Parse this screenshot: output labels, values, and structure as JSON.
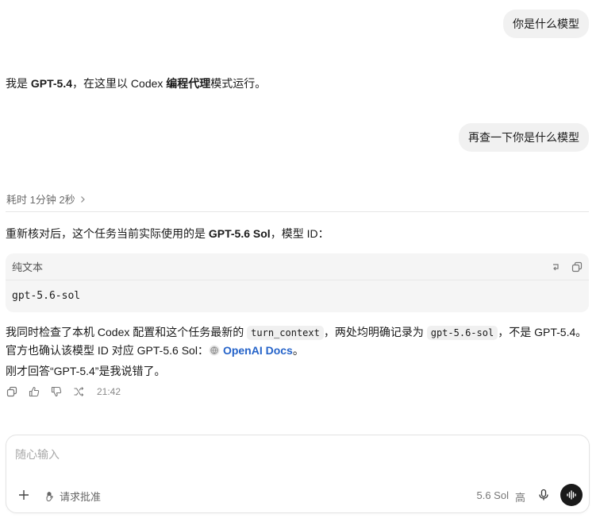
{
  "messages": {
    "user1": "你是什么模型",
    "assistant1": {
      "pre": "我是 ",
      "model": "GPT-5.4",
      "mid": "，在这里以 Codex ",
      "mode": "编程代理",
      "post": "模式运行。"
    },
    "user2": "再查一下你是什么模型",
    "elapsed": "耗时 1分钟 2秒",
    "assistant2": {
      "line1_pre": "重新核对后，这个任务当前实际使用的是 ",
      "line1_model": "GPT-5.6 Sol",
      "line1_post": "，模型 ID：",
      "code": {
        "lang": "纯文本",
        "content": "gpt-5.6-sol"
      },
      "line2_pre": "我同时检查了本机 Codex 配置和这个任务最新的 ",
      "line2_code1": "turn_context",
      "line2_mid": "，两处均明确记录为 ",
      "line2_code2": "gpt-5.6-sol",
      "line2_post": "，不是 GPT-5.4。",
      "line3_pre": "官方也确认该模型 ID 对应 GPT-5.6 Sol：",
      "line3_link": "OpenAI Docs",
      "line3_post": "。",
      "line4": "刚才回答“GPT-5.4”是我说错了。"
    },
    "timestamp": "21:42"
  },
  "composer": {
    "placeholder": "随心输入",
    "approve_label": "请求批准",
    "model": "5.6 Sol",
    "effort": "高"
  },
  "colors": {
    "link": "#2563c9",
    "bubble": "#f1f1f1",
    "send_button": "#1a1a1a"
  }
}
